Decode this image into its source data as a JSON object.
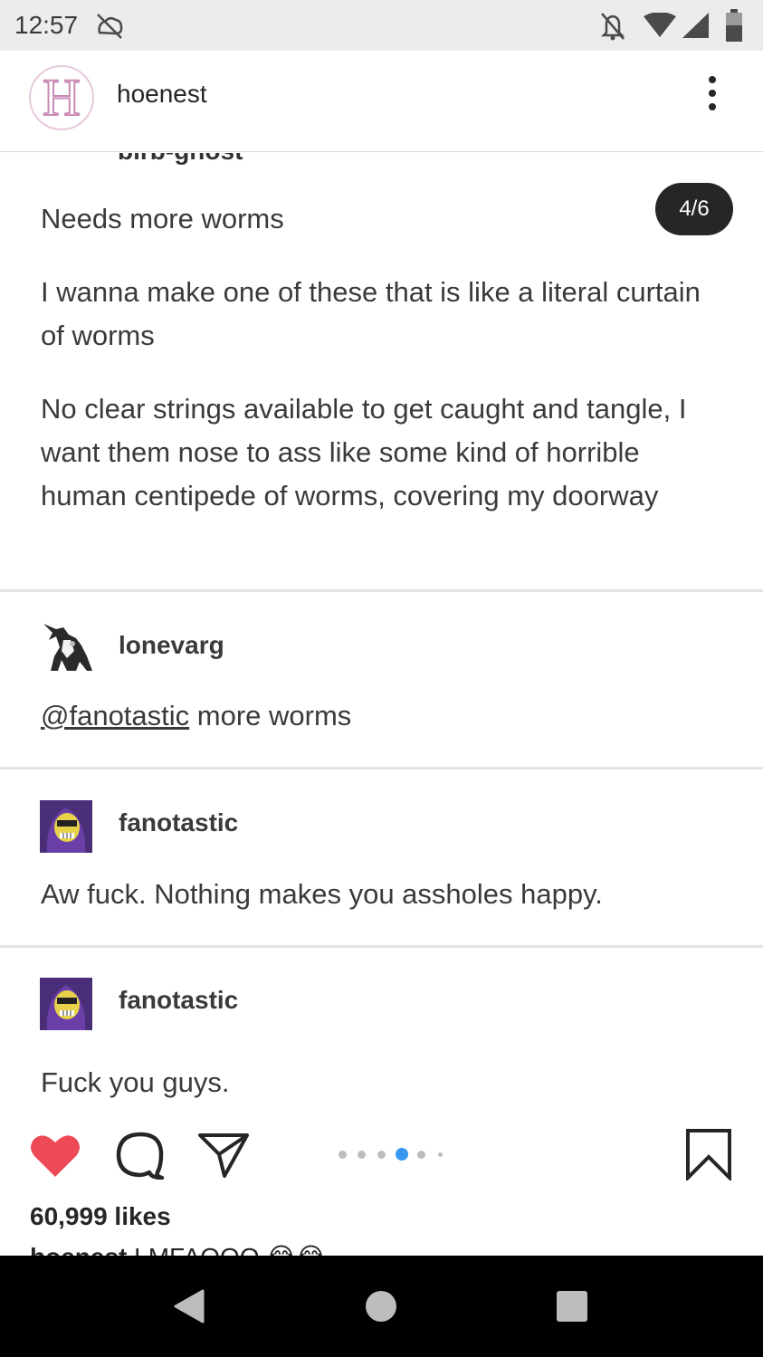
{
  "status_bar": {
    "time": "12:57",
    "icons": [
      "sync-disabled-icon",
      "notifications-off-icon",
      "wifi-icon",
      "signal-icon",
      "battery-icon"
    ]
  },
  "header": {
    "avatar_letter": "H",
    "username": "hoenest",
    "menu_icon": "more-vertical-icon"
  },
  "post": {
    "cut_off_name": "birb-ghost",
    "page_indicator": "4/6",
    "paragraphs": [
      "Needs more worms",
      "I wanna make one of these that is like a literal curtain of worms",
      "No clear strings available to get caught and tangle, I want them nose to ass like some kind of horrible human centipede of worms, covering my doorway"
    ],
    "reblogs": [
      {
        "username": "lonevarg",
        "mention": "@fanotastic",
        "text": " more worms"
      },
      {
        "username": "fanotastic",
        "text": "Aw fuck. Nothing makes you assholes happy."
      },
      {
        "username": "fanotastic",
        "text": "Fuck you guys."
      }
    ]
  },
  "actions": {
    "like_icon": "heart-icon",
    "comment_icon": "comment-icon",
    "share_icon": "send-icon",
    "save_icon": "bookmark-icon",
    "carousel_total": 6,
    "carousel_active": 4,
    "likes": "60,999 likes",
    "caption_user": "hoenest",
    "caption_text": " LMFAOOO 😂😂"
  },
  "colors": {
    "heart": "#ed4956",
    "active_dot": "#3897f0",
    "badge_bg": "#262626"
  },
  "nav_bar": {
    "back_icon": "back-triangle-icon",
    "home_icon": "home-circle-icon",
    "recents_icon": "recents-square-icon"
  }
}
